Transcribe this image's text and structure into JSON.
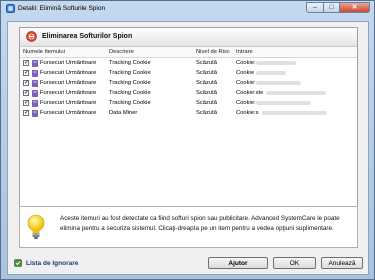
{
  "window": {
    "title": "Detalii: Elimină Softurile Spion",
    "controls": {
      "minimize": "–",
      "maximize": "□",
      "close": "✕"
    }
  },
  "panel": {
    "title": "Eliminarea Softurilor Spion",
    "columns": [
      "Numele Itemului",
      "Descriere",
      "Nivel de Risc",
      "Intrare"
    ],
    "rows": [
      {
        "checked": true,
        "name": "Fursecuri Urmăritoare",
        "description": "Tracking Cookie",
        "risk": "Scăzută",
        "entry": "Cookie:"
      },
      {
        "checked": true,
        "name": "Fursecuri Urmăritoare",
        "description": "Tracking Cookie",
        "risk": "Scăzută",
        "entry": "Cookie"
      },
      {
        "checked": true,
        "name": "Fursecuri Urmăritoare",
        "description": "Tracking Cookie",
        "risk": "Scăzută",
        "entry": "Cookie:"
      },
      {
        "checked": true,
        "name": "Fursecuri Urmăritoare",
        "description": "Tracking Cookie",
        "risk": "Scăzută",
        "entry": "Cookie:ste"
      },
      {
        "checked": true,
        "name": "Fursecuri Urmăritoare",
        "description": "Tracking Cookie",
        "risk": "Scăzută",
        "entry": "Cookie:"
      },
      {
        "checked": true,
        "name": "Fursecuri Urmăritoare",
        "description": "Data Miner",
        "risk": "Scăzută",
        "entry": "Cookie:s"
      }
    ]
  },
  "info": {
    "text": "Aceste itemuri au fost detectate ca fiind softuri spion sau publicitare. Advanced SystemCare le poate elimina pentru a securiza sistemul. Clicaţi-dreapta pe un item pentru a vedea opţiuni suplimentare."
  },
  "footer": {
    "ignore_list": "Lista de Ignorare",
    "help": "Ajutor",
    "ok": "OK",
    "cancel": "Anulează"
  },
  "colors": {
    "frame": "#b9cfe5",
    "header_icon": "#d6452c",
    "link": "#1d3a73"
  }
}
